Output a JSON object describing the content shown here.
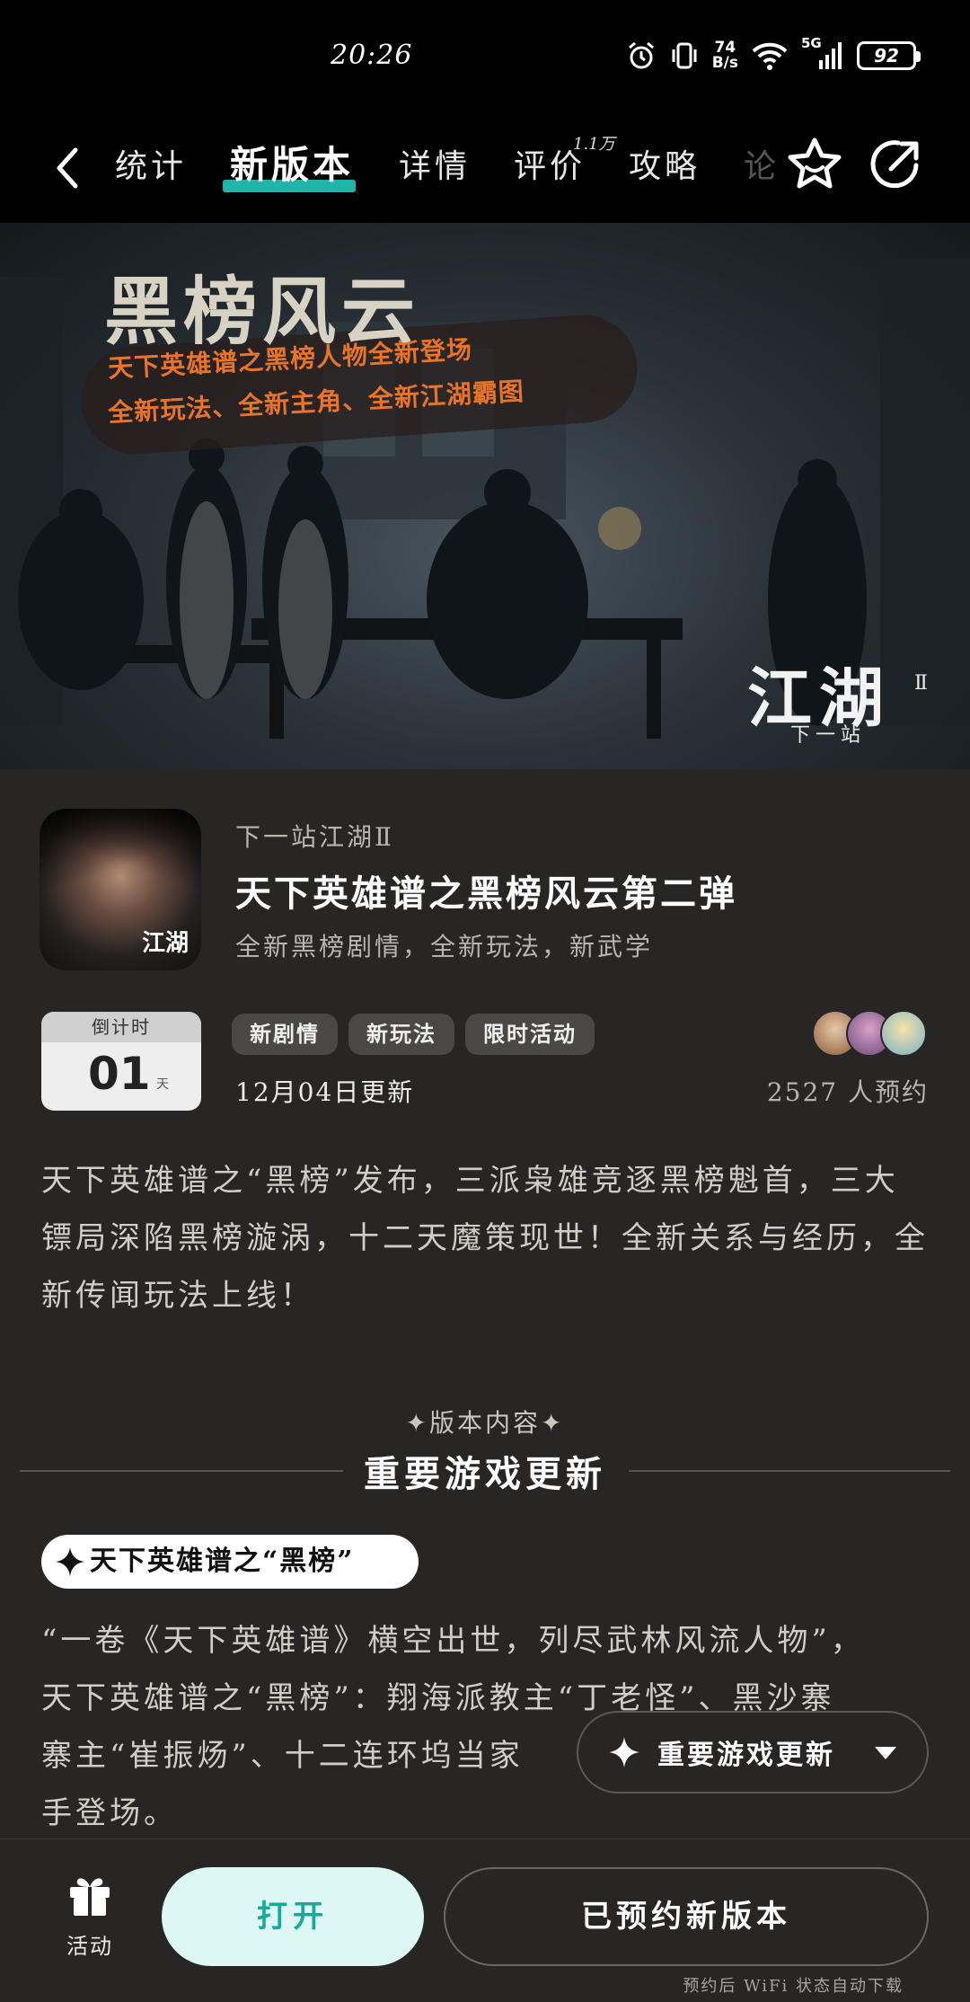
{
  "status_bar": {
    "time": "20:26",
    "net_speed_value": "74",
    "net_speed_unit": "B/s",
    "network": "5G",
    "battery": "92"
  },
  "nav": {
    "tabs": [
      {
        "label": "统计"
      },
      {
        "label": "新版本"
      },
      {
        "label": "详情"
      },
      {
        "label": "评价"
      },
      {
        "label": "攻略"
      },
      {
        "label": "论"
      }
    ],
    "review_badge": "1.1万",
    "active_tab": "新版本",
    "accent_color": "#1fb6a9"
  },
  "banner": {
    "title": "黑榜风云",
    "subtitle_line1": "天下英雄谱之黑榜人物全新登场",
    "subtitle_line2": "全新玩法、全新主角、全新江湖霸图",
    "logo_text": "江湖",
    "logo_sub": "下一站",
    "logo_num": "Ⅱ"
  },
  "app": {
    "icon_label": "江湖",
    "game_name": "下一站江湖Ⅱ",
    "update_title": "天下英雄谱之黑榜风云第二弹",
    "update_subtitle": "全新黑榜剧情，全新玩法，新武学"
  },
  "countdown": {
    "header": "倒计时",
    "value": "01",
    "unit": "天"
  },
  "tags": [
    "新剧情",
    "新玩法",
    "限时活动"
  ],
  "update_date": "12月04日更新",
  "reservations": "2527 人预约",
  "description": "天下英雄谱之“黑榜”发布，三派枭雄竞逐黑榜魁首，三大镖局深陷黑榜漩涡，十二天魔策现世！全新关系与经历，全新传闻玩法上线！",
  "section": {
    "kicker": "✦版本内容✦",
    "title": "重要游戏更新"
  },
  "chip_label": "天下英雄谱之“黑榜”",
  "content_lines": [
    "“一卷《天下英雄谱》横空出世，列尽武林风流人物”，",
    "天下英雄谱之“黑榜”：翔海派教主“丁老怪”、黑沙寨",
    "寨主“崔振炀”、十二连环坞当家",
    "手登场。"
  ],
  "float_button": {
    "label": "重要游戏更新"
  },
  "bottom_bar": {
    "activity_label": "活动",
    "open_label": "打开",
    "reserved_label": "已预约新版本",
    "auto_download_note": "预约后 WiFi 状态自动下载"
  }
}
